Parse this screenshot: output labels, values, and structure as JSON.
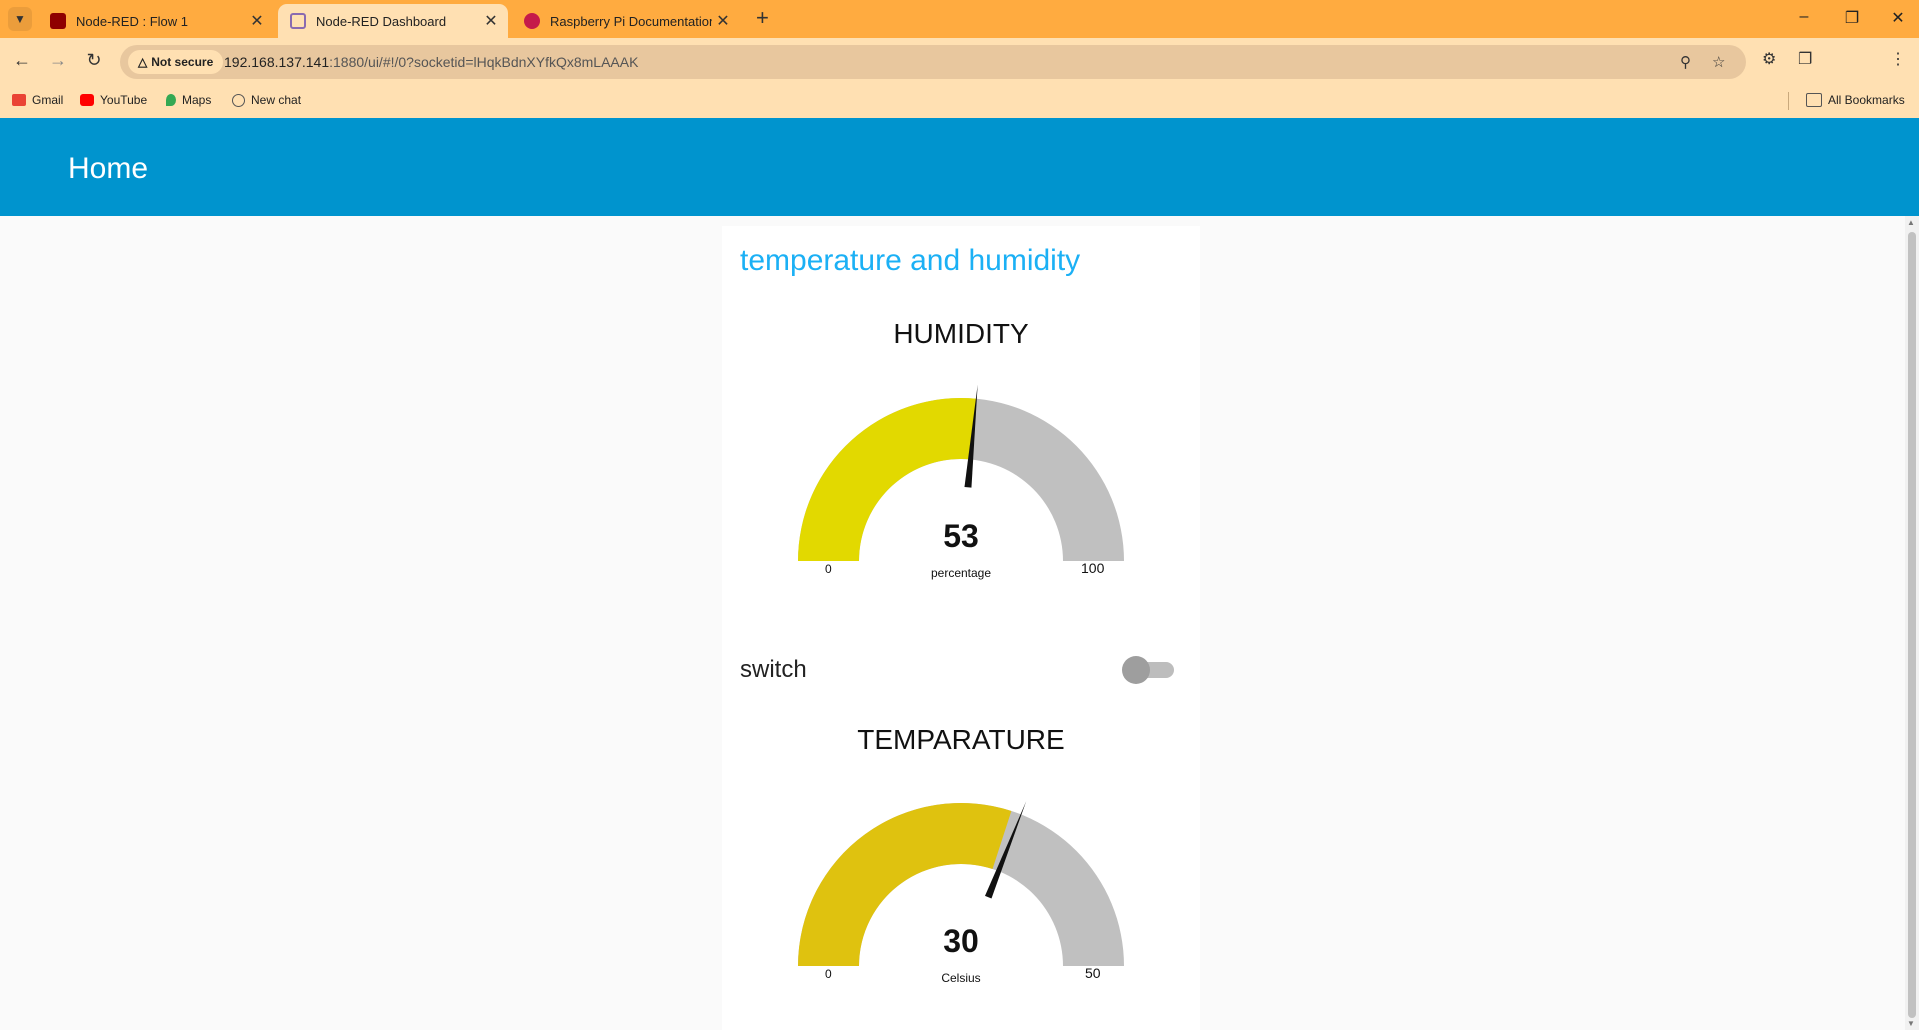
{
  "browser": {
    "tabs": [
      {
        "title": "Node-RED : Flow 1",
        "active": false
      },
      {
        "title": "Node-RED Dashboard",
        "active": true
      },
      {
        "title": "Raspberry Pi Documentation - I",
        "active": false
      }
    ],
    "security_label": "Not secure",
    "url_host": "192.168.137.141",
    "url_rest": ":1880/ui/#!/0?socketid=lHqkBdnXYfkQx8mLAAAK",
    "bookmarks": [
      {
        "label": "Gmail"
      },
      {
        "label": "YouTube"
      },
      {
        "label": "Maps"
      },
      {
        "label": "New chat"
      }
    ],
    "all_bookmarks_label": "All Bookmarks"
  },
  "dashboard": {
    "title": "Home",
    "group_title": "temperature and humidity",
    "humidity": {
      "title": "HUMIDITY",
      "value": "53",
      "value_num": 53,
      "unit": "percentage",
      "min": "0",
      "max": "100",
      "min_num": 0,
      "max_num": 100,
      "fill_color": "#e2d900",
      "needle_value_num": 53
    },
    "switch": {
      "label": "switch",
      "state": "off"
    },
    "temperature": {
      "title": "TEMPARATURE",
      "value": "30",
      "value_num": 30,
      "unit": "Celsius",
      "min": "0",
      "max": "50",
      "min_num": 0,
      "max_num": 50,
      "fill_color": "#dfc20f",
      "needle_value_num": 31
    }
  },
  "colors": {
    "header_bg": "#0094ce",
    "group_title": "#1bb0f5",
    "gauge_bg": "#c0c0c0",
    "browser_chrome": "#ffab40"
  }
}
